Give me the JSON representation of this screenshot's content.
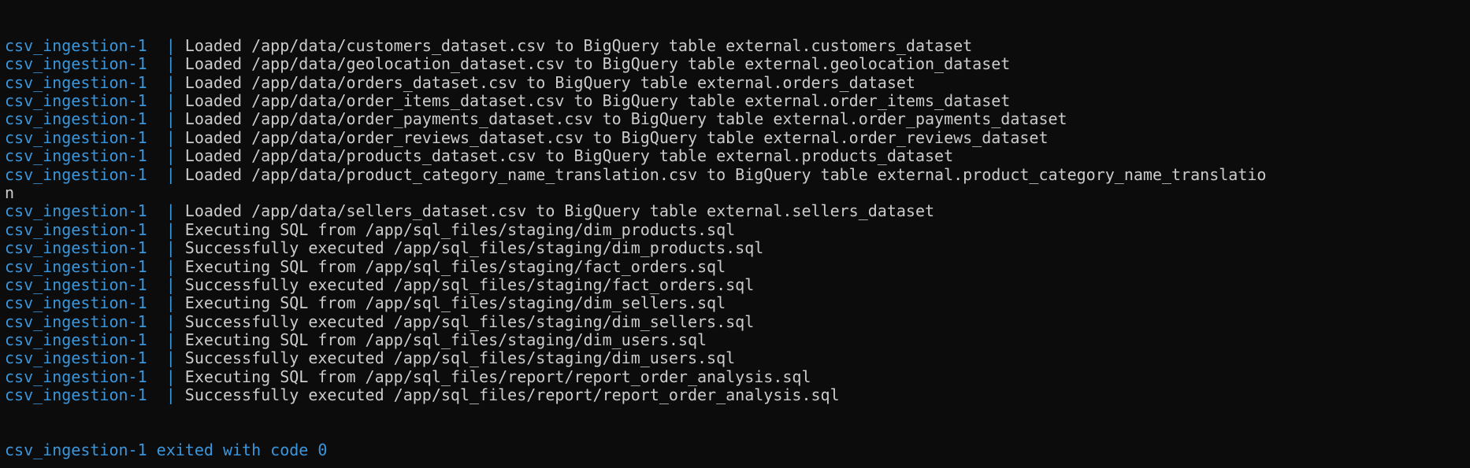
{
  "terminal": {
    "prefix_color": "#3a96dd",
    "text_color": "#cccccc",
    "background": "#0c0c0c",
    "lines": [
      {
        "prefix": "csv_ingestion-1  | ",
        "text": "Loaded /app/data/customers_dataset.csv to BigQuery table external.customers_dataset"
      },
      {
        "prefix": "csv_ingestion-1  | ",
        "text": "Loaded /app/data/geolocation_dataset.csv to BigQuery table external.geolocation_dataset"
      },
      {
        "prefix": "csv_ingestion-1  | ",
        "text": "Loaded /app/data/orders_dataset.csv to BigQuery table external.orders_dataset"
      },
      {
        "prefix": "csv_ingestion-1  | ",
        "text": "Loaded /app/data/order_items_dataset.csv to BigQuery table external.order_items_dataset"
      },
      {
        "prefix": "csv_ingestion-1  | ",
        "text": "Loaded /app/data/order_payments_dataset.csv to BigQuery table external.order_payments_dataset"
      },
      {
        "prefix": "csv_ingestion-1  | ",
        "text": "Loaded /app/data/order_reviews_dataset.csv to BigQuery table external.order_reviews_dataset"
      },
      {
        "prefix": "csv_ingestion-1  | ",
        "text": "Loaded /app/data/products_dataset.csv to BigQuery table external.products_dataset"
      },
      {
        "prefix": "csv_ingestion-1  | ",
        "text": "Loaded /app/data/product_category_name_translation.csv to BigQuery table external.product_category_name_translatio"
      },
      {
        "prefix": "",
        "text": "n"
      },
      {
        "prefix": "csv_ingestion-1  | ",
        "text": "Loaded /app/data/sellers_dataset.csv to BigQuery table external.sellers_dataset"
      },
      {
        "prefix": "csv_ingestion-1  | ",
        "text": "Executing SQL from /app/sql_files/staging/dim_products.sql"
      },
      {
        "prefix": "csv_ingestion-1  | ",
        "text": "Successfully executed /app/sql_files/staging/dim_products.sql"
      },
      {
        "prefix": "csv_ingestion-1  | ",
        "text": "Executing SQL from /app/sql_files/staging/fact_orders.sql"
      },
      {
        "prefix": "csv_ingestion-1  | ",
        "text": "Successfully executed /app/sql_files/staging/fact_orders.sql"
      },
      {
        "prefix": "csv_ingestion-1  | ",
        "text": "Executing SQL from /app/sql_files/staging/dim_sellers.sql"
      },
      {
        "prefix": "csv_ingestion-1  | ",
        "text": "Successfully executed /app/sql_files/staging/dim_sellers.sql"
      },
      {
        "prefix": "csv_ingestion-1  | ",
        "text": "Executing SQL from /app/sql_files/staging/dim_users.sql"
      },
      {
        "prefix": "csv_ingestion-1  | ",
        "text": "Successfully executed /app/sql_files/staging/dim_users.sql"
      },
      {
        "prefix": "csv_ingestion-1  | ",
        "text": "Executing SQL from /app/sql_files/report/report_order_analysis.sql"
      },
      {
        "prefix": "csv_ingestion-1  | ",
        "text": "Successfully executed /app/sql_files/report/report_order_analysis.sql"
      }
    ],
    "exit_line": "csv_ingestion-1 exited with code 0"
  }
}
